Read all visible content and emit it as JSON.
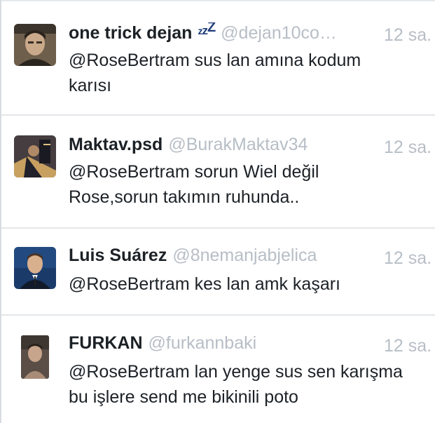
{
  "tweets": [
    {
      "display_name": "one trick dejan",
      "status_icon": "sleep-zzz-icon",
      "status_glyphs": [
        "z",
        "z",
        "Z"
      ],
      "handle": "@dejan10co…",
      "time": "12 sa.",
      "text": "@RoseBertram sus lan amına kodum\nkarısı"
    },
    {
      "display_name": "Maktav.psd",
      "handle": "@BurakMaktav34",
      "time": "12 sa.",
      "text": "@RoseBertram sorun Wiel değil\nRose,sorun takımın ruhunda.."
    },
    {
      "display_name": "Luis Suárez",
      "handle": "@8nemanjabjelica",
      "time": "12 sa.",
      "text": "@RoseBertram kes lan amk kaşarı"
    },
    {
      "display_name": "FURKAN",
      "handle": "@furkannbaki",
      "time": "12 sa.",
      "text": "@RoseBertram lan yenge sus sen karışma\nbu işlere send me bikinili poto"
    }
  ],
  "colors": {
    "name": "#1c2126",
    "muted": "#b7bec6",
    "separator": "#e3e6e9",
    "sleep_icon": "#1f3d7a"
  }
}
